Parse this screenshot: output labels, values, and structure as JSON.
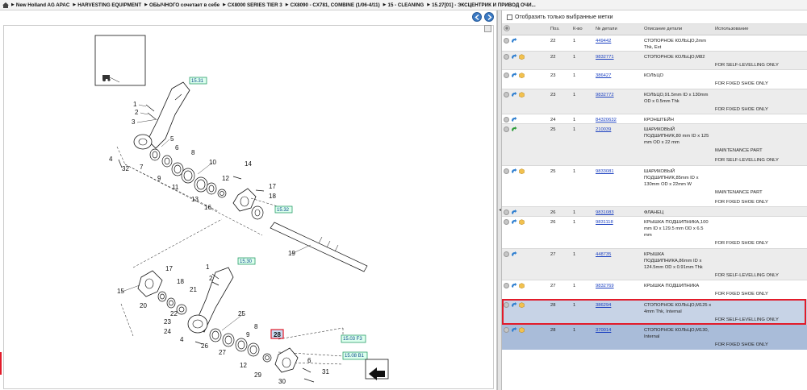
{
  "breadcrumb": [
    "New Holland AG APAC",
    "HARVESTING EQUIPMENT",
    "ОБЫЧНОГО сочетает в себе",
    "CX8000 SERIES TIER 3",
    "CX8090 - CX781, COMBINE (1/06-4/11)",
    "15 - CLEANING",
    "15.27[01] - ЭКСЦЕНТРИК И ПРИВОД ОЧИ..."
  ],
  "filter": {
    "label": "Отобразить только выбранные метки"
  },
  "columns": {
    "pos": "Поз.",
    "qty": "К-во",
    "part": "№ детали",
    "desc": "Описание детали",
    "usage": "Использование"
  },
  "rows": [
    {
      "pos": "22",
      "qty": "1",
      "part": "449442",
      "desc": "СТОПОРНОЕ КОЛЬЦО,2mm Thk, Ext",
      "notes": [],
      "icon": "arrow"
    },
    {
      "pos": "22",
      "qty": "1",
      "part": "9832771",
      "desc": "СТОПОРНОЕ КОЛЬЦО,M82",
      "notes": [
        "FOR SELF-LEVELLING ONLY"
      ],
      "icon": "box"
    },
    {
      "pos": "23",
      "qty": "1",
      "part": "386427",
      "desc": "КОЛЬЦО",
      "notes": [
        "FOR FIXED SHOE ONLY"
      ],
      "icon": "box"
    },
    {
      "pos": "23",
      "qty": "1",
      "part": "9832772",
      "desc": "КОЛЬЦО,91.5mm ID x 130mm OD x 0.5mm Thk",
      "notes": [
        "FOR FIXED SHOE ONLY"
      ],
      "icon": "box"
    },
    {
      "pos": "24",
      "qty": "1",
      "part": "84320632",
      "desc": "КРОНШТЕЙН",
      "notes": [],
      "icon": "arrow"
    },
    {
      "pos": "25",
      "qty": "1",
      "part": "210039",
      "desc": "ШАРИКОВЫЙ ПОДШИПНИК,80 mm ID x 125 mm OD x 22 mm",
      "notes": [
        "MAINTENANCE PART",
        "FOR SELF-LEVELLING ONLY"
      ],
      "icon": "green"
    },
    {
      "pos": "25",
      "qty": "1",
      "part": "9833081",
      "desc": "ШАРИКОВЫЙ ПОДШИПНИК,85mm ID x 130mm OD x 22mm W",
      "notes": [
        "MAINTENANCE PART",
        "FOR FIXED SHOE ONLY"
      ],
      "icon": "box"
    },
    {
      "pos": "26",
      "qty": "1",
      "part": "9831083",
      "desc": "ФЛАНЕЦ",
      "notes": [],
      "icon": "arrow"
    },
    {
      "pos": "26",
      "qty": "1",
      "part": "9831118",
      "desc": "КРЫШКА ПОДШИПНИКА,100 mm ID x 129.5 mm OD x 6.5 mm",
      "notes": [
        "FOR FIXED SHOE ONLY"
      ],
      "icon": "box"
    },
    {
      "pos": "27",
      "qty": "1",
      "part": "448735",
      "desc": "КРЫШКА ПОДШИПНИКА,86mm ID x 124.5mm OD x 0.91mm Thk",
      "notes": [
        "FOR SELF-LEVELLING ONLY"
      ],
      "icon": "arrow"
    },
    {
      "pos": "27",
      "qty": "1",
      "part": "9832769",
      "desc": "КРЫШКА ПОДШИПНИКА",
      "notes": [
        "FOR FIXED SHOE ONLY"
      ],
      "icon": "box"
    },
    {
      "pos": "28",
      "qty": "1",
      "part": "386294",
      "desc": "СТОПОРНОЕ КОЛЬЦО,M125 x 4mm Thk, Internal",
      "notes": [
        "FOR SELF-LEVELLING ONLY"
      ],
      "icon": "box",
      "state": "selected"
    },
    {
      "pos": "28",
      "qty": "1",
      "part": "370014",
      "desc": "СТОПОРНОЕ КОЛЬЦО,M130, Internal",
      "notes": [
        "FOR FIXED SHOE ONLY"
      ],
      "icon": "box",
      "state": "selected2"
    }
  ],
  "diagram": {
    "refs": [
      "15.31",
      "15.32",
      "15.30",
      "15.03 F3",
      "15.08 B1"
    ],
    "highlight": "28",
    "labels": [
      "1",
      "2",
      "3",
      "5",
      "6",
      "8",
      "4",
      "32",
      "7",
      "9",
      "10",
      "11",
      "12",
      "14",
      "13",
      "16",
      "17",
      "18",
      "19",
      "17",
      "15",
      "18",
      "1",
      "2",
      "20",
      "21",
      "22",
      "23",
      "25",
      "4",
      "24",
      "26",
      "8",
      "27",
      "9",
      "12",
      "29",
      "6",
      "30",
      "31"
    ]
  }
}
